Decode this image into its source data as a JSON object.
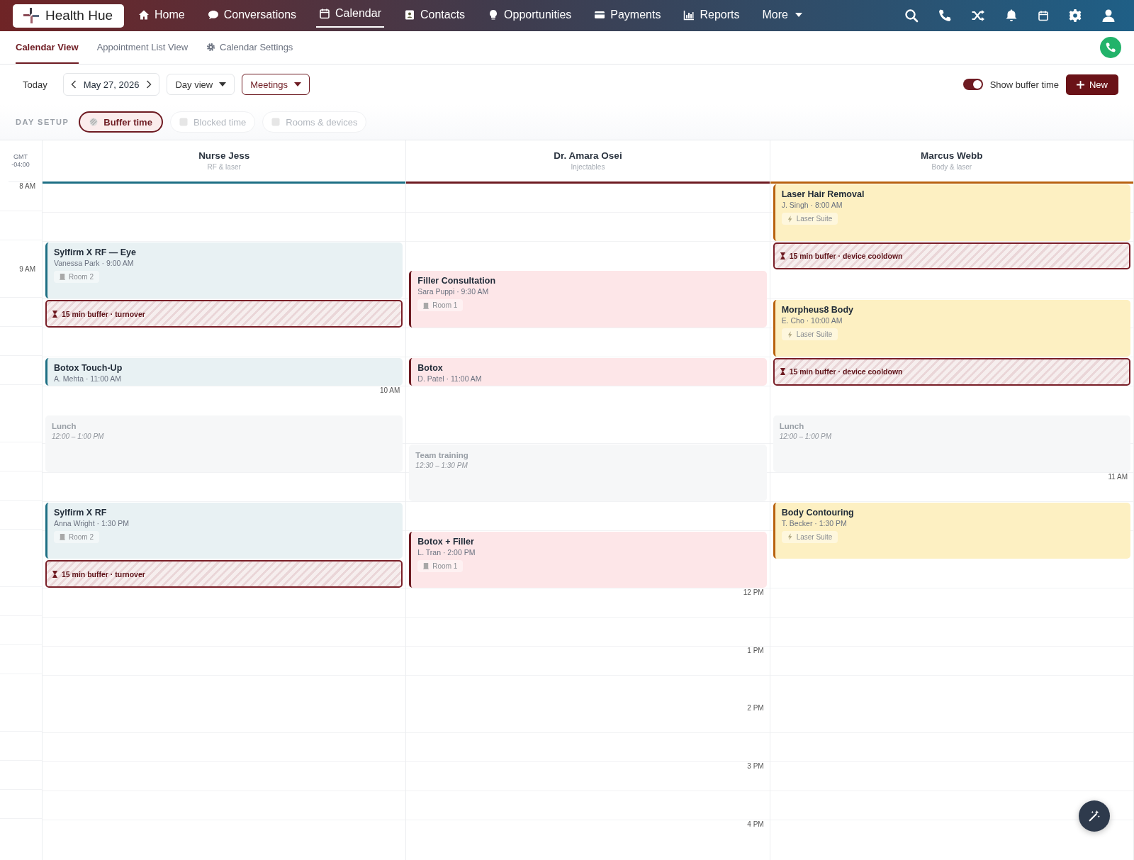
{
  "logo": "Health Hue",
  "nav": [
    {
      "label": "Home",
      "selected": false,
      "kind": "link"
    },
    {
      "label": "Conversations",
      "selected": false,
      "kind": "link"
    },
    {
      "label": "Calendar",
      "selected": true,
      "kind": "link"
    },
    {
      "label": "Contacts",
      "selected": false,
      "kind": "link"
    },
    {
      "label": "Opportunities",
      "selected": false,
      "kind": "link"
    },
    {
      "label": "Payments",
      "selected": false,
      "kind": "link"
    },
    {
      "label": "Reports",
      "selected": false,
      "kind": "link"
    },
    {
      "label": "More",
      "selected": false,
      "kind": "menu"
    }
  ],
  "subtabs": [
    {
      "label": "Calendar View",
      "selected": true,
      "kind": "tab"
    },
    {
      "label": "Appointment List View",
      "selected": false,
      "kind": "tab"
    },
    {
      "label": "Calendar Settings",
      "selected": false,
      "kind": "settings"
    }
  ],
  "toolbar": {
    "today": "Today",
    "date": "May 27, 2026",
    "view": {
      "label": "Day view",
      "active": false
    },
    "filter": {
      "label": "Meetings",
      "active": true
    },
    "buffer_toggle": {
      "label": "Show buffer time",
      "on": true
    },
    "new_button": "New"
  },
  "day_setup": {
    "label": "DAY SETUP",
    "chips": [
      {
        "label": "Buffer time",
        "selected": true
      },
      {
        "label": "Blocked time",
        "selected": false
      },
      {
        "label": "Rooms & devices",
        "selected": false
      }
    ]
  },
  "calendar": {
    "timezone": "GMT -04:00",
    "gutter_times": [
      "8 AM",
      "9 AM"
    ],
    "columns": [
      {
        "name": "Nurse Jess",
        "specialty": "RF & laser",
        "color": "#1d6f84",
        "times": [
          "10 AM"
        ],
        "events": [
          {
            "kind": "appointment",
            "title": "Sylfirm X RF — Eye",
            "meta": "Vanessa Park · 9:00 AM",
            "location": "Room 2"
          },
          {
            "kind": "buffer",
            "label": "15 min buffer · turnover"
          },
          {
            "kind": "appointment",
            "title": "Botox Touch-Up",
            "meta": "A. Mehta · 11:00 AM"
          },
          {
            "kind": "blocked",
            "title": "Lunch",
            "time": "12:00 – 1:00 PM"
          },
          {
            "kind": "appointment",
            "title": "Sylfirm X RF",
            "meta": "Anna Wright · 1:30 PM",
            "location": "Room 2"
          },
          {
            "kind": "buffer",
            "label": "15 min buffer · turnover"
          }
        ]
      },
      {
        "name": "Dr. Amara Osei",
        "specialty": "Injectables",
        "color": "#6e1b22",
        "times": [
          "12 PM",
          "1 PM",
          "2 PM",
          "3 PM",
          "4 PM"
        ],
        "events": [
          {
            "kind": "appointment",
            "title": "Filler Consultation",
            "meta": "Sara Puppi · 9:30 AM",
            "location": "Room 1"
          },
          {
            "kind": "appointment",
            "title": "Botox",
            "meta": "D. Patel · 11:00 AM"
          },
          {
            "kind": "blocked",
            "title": "Team training",
            "time": "12:30 – 1:30 PM"
          },
          {
            "kind": "appointment",
            "title": "Botox + Filler",
            "meta": "L. Tran · 2:00 PM",
            "location": "Room 1"
          }
        ]
      },
      {
        "name": "Marcus Webb",
        "specialty": "Body & laser",
        "color": "#b8620f",
        "times": [
          "11 AM"
        ],
        "events": [
          {
            "kind": "appointment",
            "title": "Laser Hair Removal",
            "meta": "J. Singh · 8:00 AM",
            "location": "Laser Suite"
          },
          {
            "kind": "buffer",
            "label": "15 min buffer · device cooldown"
          },
          {
            "kind": "appointment",
            "title": "Morpheus8 Body",
            "meta": "E. Cho · 10:00 AM",
            "location": "Laser Suite"
          },
          {
            "kind": "buffer",
            "label": "15 min buffer · device cooldown"
          },
          {
            "kind": "blocked",
            "title": "Lunch",
            "time": "12:00 – 1:00 PM"
          },
          {
            "kind": "appointment",
            "title": "Body Contouring",
            "meta": "T. Becker · 1:30 PM",
            "location": "Laser Suite"
          }
        ]
      }
    ]
  }
}
